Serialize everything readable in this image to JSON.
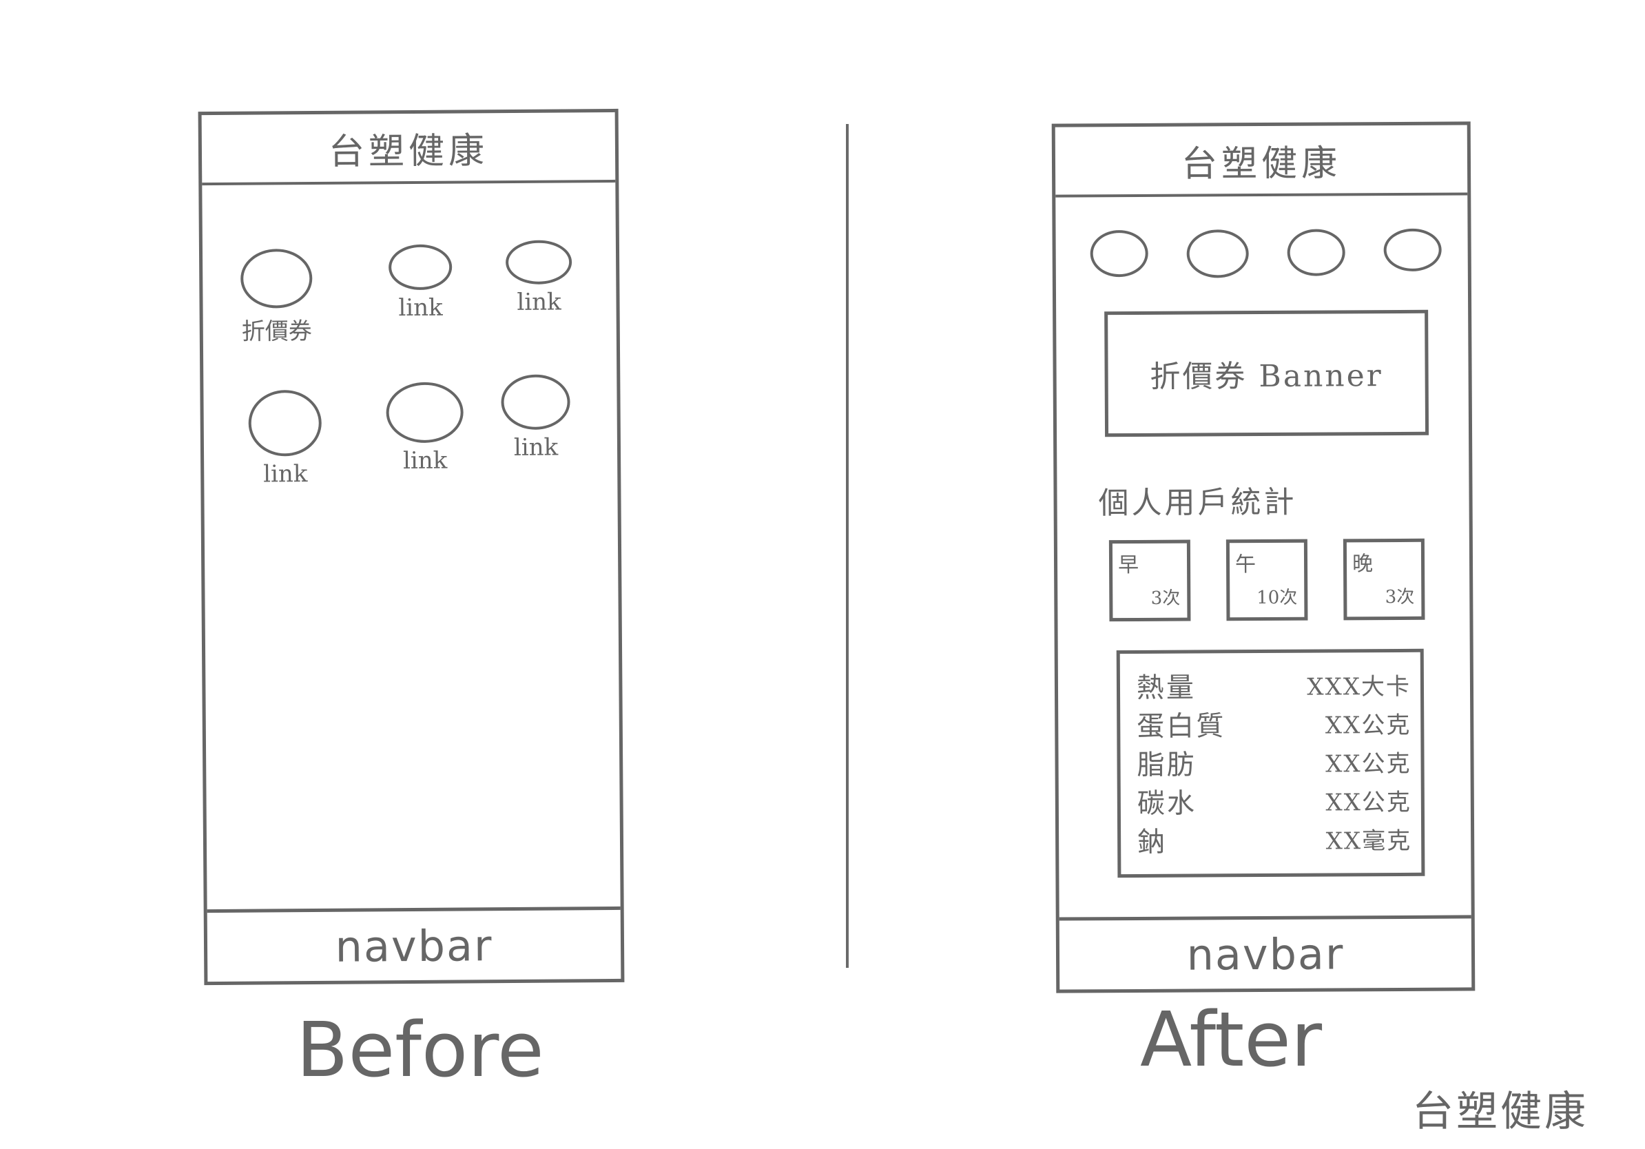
{
  "before": {
    "header_title": "台塑健康",
    "links": [
      {
        "label": "折價券"
      },
      {
        "label": "link"
      },
      {
        "label": "link"
      },
      {
        "label": "link"
      },
      {
        "label": "link"
      },
      {
        "label": "link"
      }
    ],
    "navbar_label": "navbar",
    "caption": "Before"
  },
  "after": {
    "header_title": "台塑健康",
    "banner_label": "折價券 Banner",
    "stats_heading": "個人用戶統計",
    "meals": [
      {
        "name": "早",
        "count": "3次"
      },
      {
        "name": "午",
        "count": "10次"
      },
      {
        "name": "晚",
        "count": "3次"
      }
    ],
    "nutrition": [
      {
        "name": "熱量",
        "value": "XXX大卡"
      },
      {
        "name": "蛋白質",
        "value": "XX公克"
      },
      {
        "name": "脂肪",
        "value": "XX公克"
      },
      {
        "name": "碳水",
        "value": "XX公克"
      },
      {
        "name": "鈉",
        "value": "XX毫克"
      }
    ],
    "navbar_label": "navbar",
    "caption": "After"
  },
  "signature": "台塑健康"
}
